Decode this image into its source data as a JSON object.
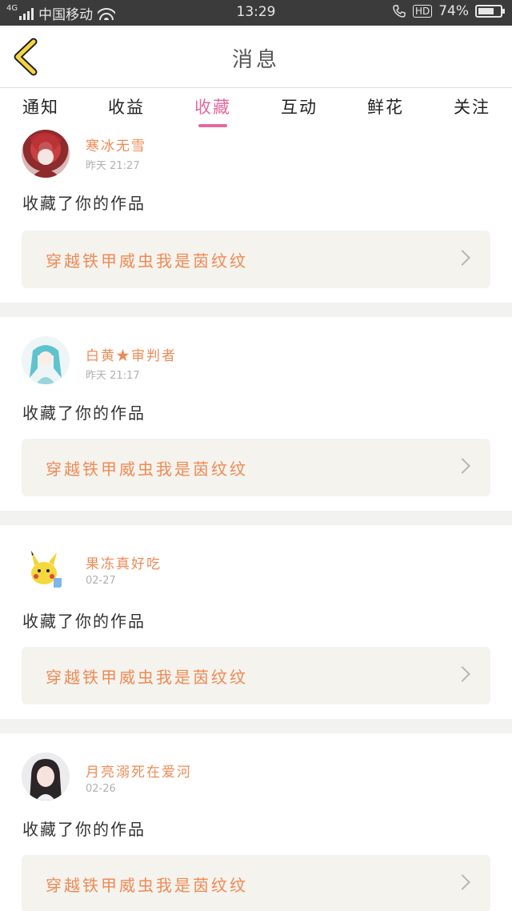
{
  "status_bar": {
    "network": "4G",
    "carrier": "中国移动",
    "time": "13:29",
    "hd_label": "HD",
    "battery": "74%",
    "battery_level": 0.74
  },
  "header": {
    "title": "消息",
    "back_icon": "chevron-left-icon",
    "back_color": "#f5d542"
  },
  "tabs": [
    {
      "label": "通知"
    },
    {
      "label": "收益"
    },
    {
      "label": "收藏",
      "active": true
    },
    {
      "label": "互动"
    },
    {
      "label": "鲜花"
    },
    {
      "label": "关注"
    }
  ],
  "colors": {
    "accent": "#e26aa0",
    "name": "#ef8a55"
  },
  "feed": [
    {
      "user": "寒冰无雪",
      "date": "昨天 21:27",
      "action": "收藏了你的作品",
      "work": "穿越铁甲威虫我是茵纹纹",
      "avatar": "red-anime-avatar"
    },
    {
      "user": "白黄★审判者",
      "date": "昨天 21:17",
      "action": "收藏了你的作品",
      "work": "穿越铁甲威虫我是茵纹纹",
      "avatar": "miku-avatar"
    },
    {
      "user": "果冻真好吃",
      "date": "02-27",
      "action": "收藏了你的作品",
      "work": "穿越铁甲威虫我是茵纹纹",
      "avatar": "pikachu-avatar"
    },
    {
      "user": "月亮溺死在爱河",
      "date": "02-26",
      "action": "收藏了你的作品",
      "work": "穿越铁甲威虫我是茵纹纹",
      "avatar": "girl-photo-avatar"
    }
  ]
}
